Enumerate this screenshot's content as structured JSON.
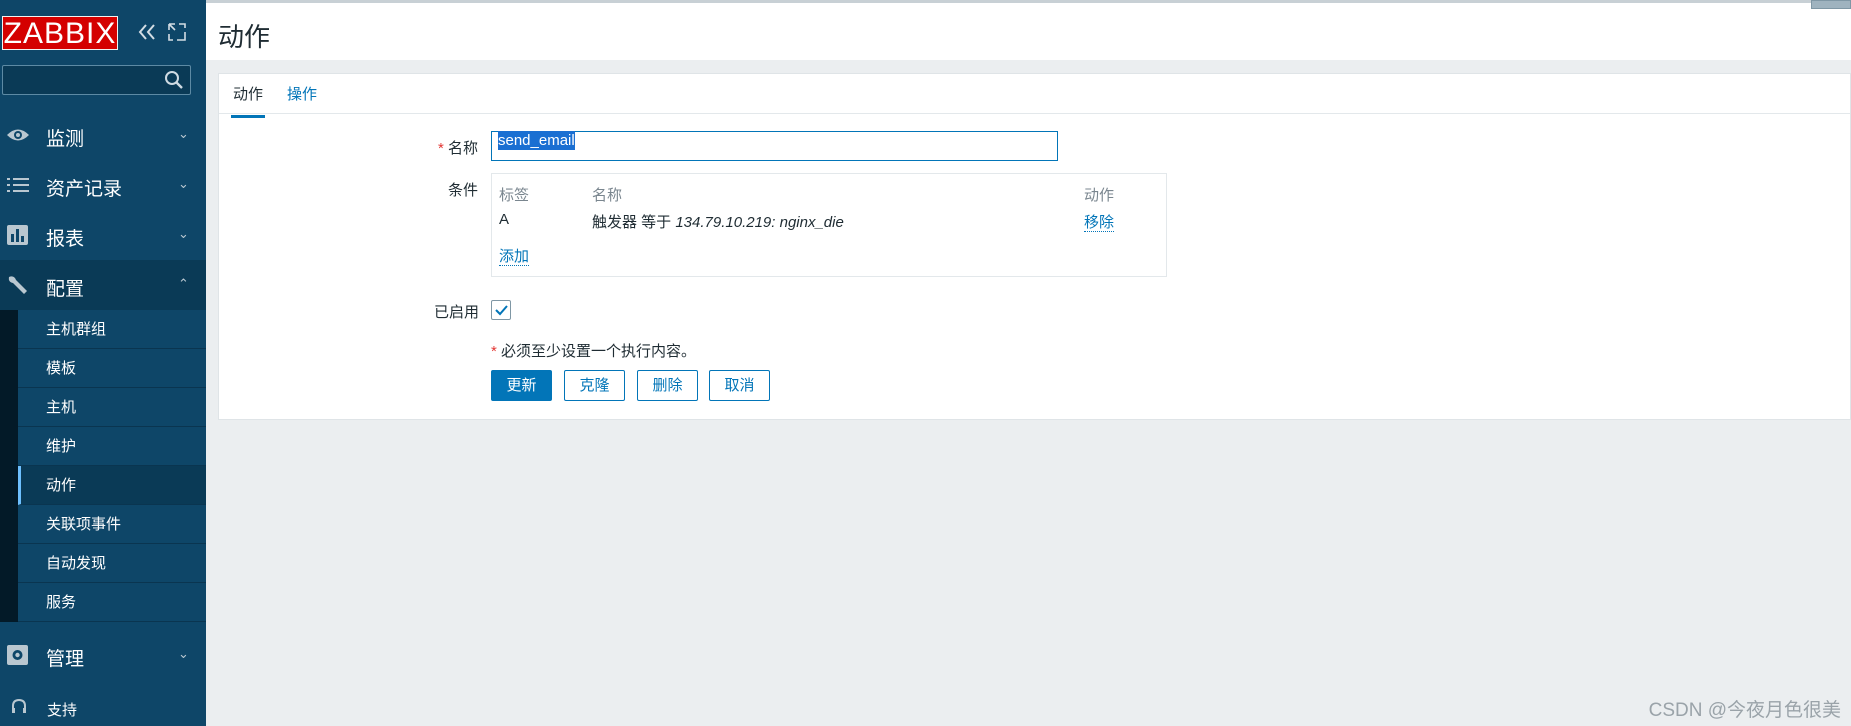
{
  "sidebar": {
    "logo": "ZABBIX",
    "search_placeholder": "",
    "menu": [
      {
        "label": "监测",
        "icon": "eye-icon"
      },
      {
        "label": "资产记录",
        "icon": "list-icon"
      },
      {
        "label": "报表",
        "icon": "bar-chart-icon"
      },
      {
        "label": "配置",
        "icon": "wrench-icon"
      },
      {
        "label": "管理",
        "icon": "gear-icon"
      }
    ],
    "submenu": [
      "主机群组",
      "模板",
      "主机",
      "维护",
      "动作",
      "关联项事件",
      "自动发现",
      "服务"
    ],
    "support": "支持"
  },
  "header": {
    "title": "动作"
  },
  "tabs": {
    "action": "动作",
    "operations": "操作"
  },
  "form": {
    "name_label": "名称",
    "name_value": "send_email",
    "conditions_label": "条件",
    "conditions": {
      "headers": {
        "label": "标签",
        "name": "名称",
        "action": "动作"
      },
      "rows": [
        {
          "label": "A",
          "name_prefix": "触发器 等于 ",
          "name_value": "134.79.10.219: nginx_die",
          "action": "移除"
        }
      ],
      "add": "添加"
    },
    "enabled_label": "已启用",
    "enabled": true,
    "hint": "必须至少设置一个执行内容。"
  },
  "buttons": {
    "update": "更新",
    "clone": "克隆",
    "delete": "删除",
    "cancel": "取消"
  },
  "watermark": "CSDN @今夜月色很美",
  "colors": {
    "sidebar": "#0e4668",
    "accent": "#0275b8",
    "logo": "#d40000",
    "required": "#e33734"
  }
}
